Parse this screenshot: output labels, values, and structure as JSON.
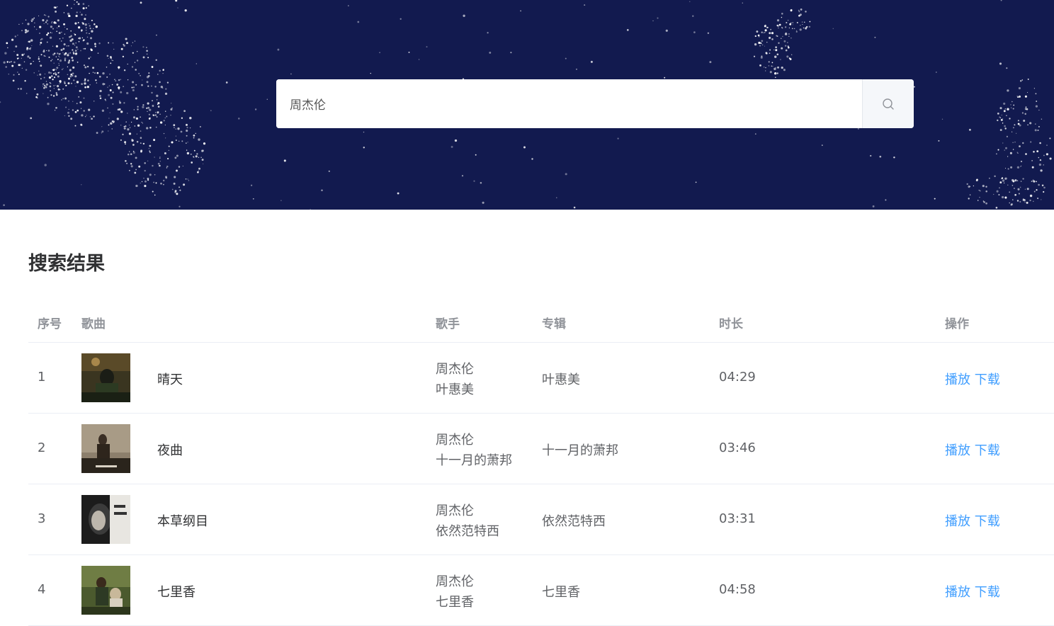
{
  "search": {
    "value": "周杰伦"
  },
  "section_title": "搜索结果",
  "table": {
    "headers": {
      "index": "序号",
      "song": "歌曲",
      "artist": "歌手",
      "album": "专辑",
      "duration": "时长",
      "actions": "操作"
    },
    "rows": [
      {
        "index": "1",
        "song": "晴天",
        "artist_line1": "周杰伦",
        "artist_line2": "叶惠美",
        "album": "叶惠美",
        "duration": "04:29",
        "play": "播放",
        "download": "下载"
      },
      {
        "index": "2",
        "song": "夜曲",
        "artist_line1": "周杰伦",
        "artist_line2": "十一月的萧邦",
        "album": "十一月的萧邦",
        "duration": "03:46",
        "play": "播放",
        "download": "下载"
      },
      {
        "index": "3",
        "song": "本草纲目",
        "artist_line1": "周杰伦",
        "artist_line2": "依然范特西",
        "album": "依然范特西",
        "duration": "03:31",
        "play": "播放",
        "download": "下载"
      },
      {
        "index": "4",
        "song": "七里香",
        "artist_line1": "周杰伦",
        "artist_line2": "七里香",
        "album": "七里香",
        "duration": "04:58",
        "play": "播放",
        "download": "下载"
      }
    ]
  },
  "colors": {
    "banner": "#121a4f",
    "link": "#409eff"
  },
  "icons": {
    "search_button": "search-icon"
  }
}
